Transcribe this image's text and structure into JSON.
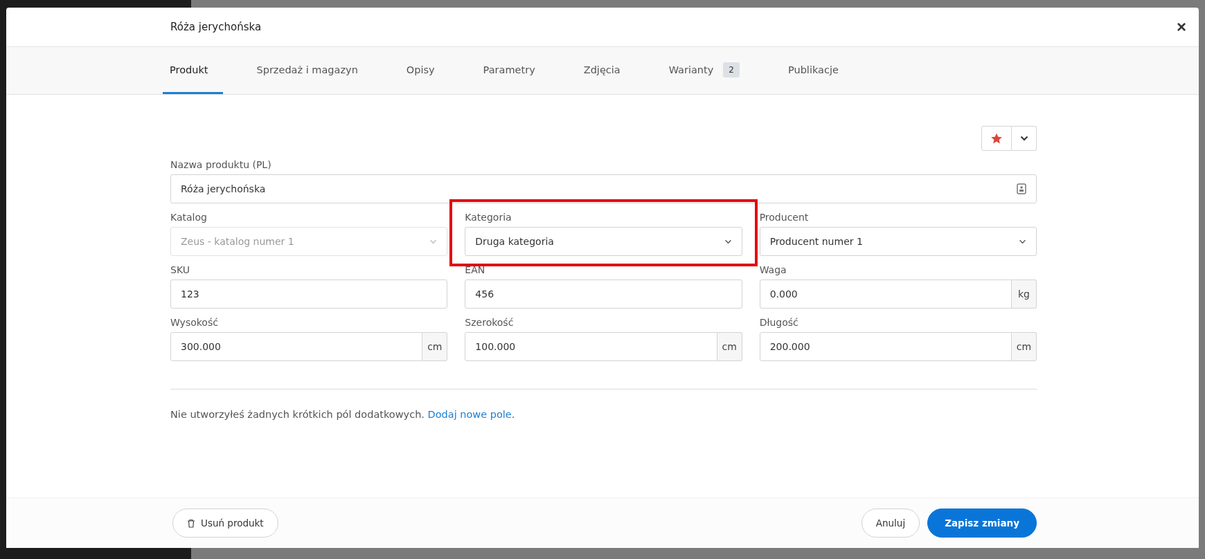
{
  "modal": {
    "title": "Róża jerychońska",
    "close": "×"
  },
  "tabs": [
    {
      "label": "Produkt",
      "selected": true
    },
    {
      "label": "Sprzedaż i magazyn",
      "selected": false
    },
    {
      "label": "Opisy",
      "selected": false
    },
    {
      "label": "Parametry",
      "selected": false
    },
    {
      "label": "Zdjęcia",
      "selected": false
    },
    {
      "label": "Warianty",
      "selected": false,
      "badge": "2"
    },
    {
      "label": "Publikacje",
      "selected": false
    }
  ],
  "name_field": {
    "label": "Nazwa produktu (PL)",
    "value": "Róża jerychońska"
  },
  "rows": [
    [
      {
        "kind": "select",
        "label": "Katalog",
        "value": "Zeus - katalog numer 1",
        "disabled": true,
        "highlighted": false
      },
      {
        "kind": "select",
        "label": "Kategoria",
        "value": "Druga kategoria",
        "disabled": false,
        "highlighted": true
      },
      {
        "kind": "select",
        "label": "Producent",
        "value": "Producent numer 1",
        "disabled": false,
        "highlighted": false
      }
    ],
    [
      {
        "kind": "text",
        "label": "SKU",
        "value": "123",
        "disabled": false,
        "highlighted": false
      },
      {
        "kind": "text",
        "label": "EAN",
        "value": "456",
        "disabled": false,
        "highlighted": false
      },
      {
        "kind": "unit",
        "label": "Waga",
        "value": "0.000",
        "unit": "kg",
        "disabled": false,
        "highlighted": false
      }
    ],
    [
      {
        "kind": "unit",
        "label": "Wysokość",
        "value": "300.000",
        "unit": "cm",
        "disabled": false,
        "highlighted": false
      },
      {
        "kind": "unit",
        "label": "Szerokość",
        "value": "100.000",
        "unit": "cm",
        "disabled": false,
        "highlighted": false
      },
      {
        "kind": "unit",
        "label": "Długość",
        "value": "200.000",
        "unit": "cm",
        "disabled": false,
        "highlighted": false
      }
    ]
  ],
  "notice": {
    "text": "Nie utworzyłeś żadnych krótkich pól dodatkowych.",
    "link": "Dodaj nowe pole",
    "end": "."
  },
  "footer": {
    "delete": "Usuń produkt",
    "cancel": "Anuluj",
    "save": "Zapisz zmiany"
  }
}
